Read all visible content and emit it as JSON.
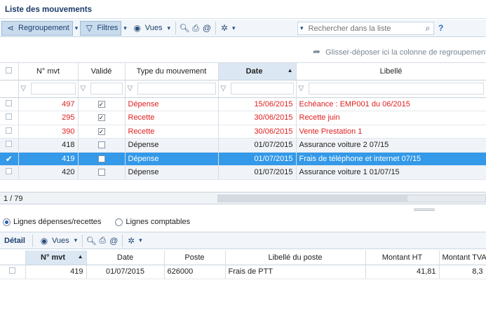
{
  "window": {
    "title": "Liste des mouvements"
  },
  "toolbar": {
    "grouping_label": "Regroupement",
    "filters_label": "Filtres",
    "views_label": "Vues",
    "search_placeholder": "Rechercher dans la liste",
    "help_label": "?"
  },
  "group_hint": "Glisser-déposer ici la colonne de regroupement",
  "grid": {
    "headers": {
      "num": "N° mvt",
      "valid": "Validé",
      "type": "Type du mouvement",
      "date": "Date",
      "label": "Libellé"
    },
    "sort_indicator": "▲",
    "rows": [
      {
        "num": "497",
        "valid": true,
        "type": "Dépense",
        "date": "15/06/2015",
        "label": "Echéance : EMP001 du 06/2015",
        "state": "red"
      },
      {
        "num": "295",
        "valid": true,
        "type": "Recette",
        "date": "30/06/2015",
        "label": "Recette juin",
        "state": "red"
      },
      {
        "num": "390",
        "valid": true,
        "type": "Recette",
        "date": "30/06/2015",
        "label": "Vente Prestation 1",
        "state": "red"
      },
      {
        "num": "418",
        "valid": false,
        "type": "Dépense",
        "date": "01/07/2015",
        "label": "Assurance voiture 2 07/15",
        "state": "normal"
      },
      {
        "num": "419",
        "valid": false,
        "type": "Dépense",
        "date": "01/07/2015",
        "label": "Frais de téléphone et internet 07/15",
        "state": "selected"
      },
      {
        "num": "420",
        "valid": false,
        "type": "Dépense",
        "date": "01/07/2015",
        "label": "Assurance voiture 1 01/07/15",
        "state": "normal"
      }
    ],
    "record_count": "1 / 79"
  },
  "view_options": {
    "lines_income_expense": "Lignes dépenses/recettes",
    "accounting_lines": "Lignes comptables",
    "selected": "lines_income_expense"
  },
  "detail": {
    "title": "Détail",
    "views_label": "Vues",
    "headers": {
      "num": "N° mvt",
      "date": "Date",
      "post": "Poste",
      "post_label": "Libellé du poste",
      "amount_ht": "Montant HT",
      "amount_tva": "Montant TVA"
    },
    "rows": [
      {
        "num": "419",
        "date": "01/07/2015",
        "post": "626000",
        "post_label": "Frais de PTT",
        "amount_ht": "41,81",
        "amount_tva": "8,3"
      }
    ]
  },
  "colors": {
    "selection": "#3399e8",
    "red_row": "#e02020",
    "toolbar_bg": "#f2f6fa",
    "header_sorted": "#dbe7f3"
  }
}
